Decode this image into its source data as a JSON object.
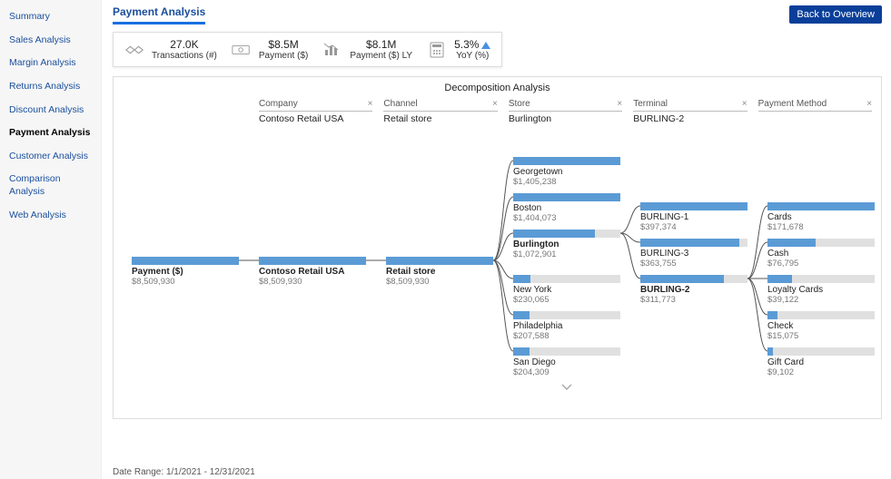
{
  "sidebar": {
    "items": [
      {
        "label": "Summary"
      },
      {
        "label": "Sales Analysis"
      },
      {
        "label": "Margin Analysis"
      },
      {
        "label": "Returns Analysis"
      },
      {
        "label": "Discount Analysis"
      },
      {
        "label": "Payment Analysis"
      },
      {
        "label": "Customer Analysis"
      },
      {
        "label": "Comparison Analysis"
      },
      {
        "label": "Web Analysis"
      }
    ],
    "active_index": 5
  },
  "header": {
    "title": "Payment Analysis",
    "back_label": "Back to Overview"
  },
  "kpis": [
    {
      "icon": "handshake-icon",
      "value": "27.0K",
      "label": "Transactions (#)"
    },
    {
      "icon": "cash-icon",
      "value": "$8.5M",
      "label": "Payment ($)"
    },
    {
      "icon": "chart-icon",
      "value": "$8.1M",
      "label": "Payment ($) LY"
    },
    {
      "icon": "calculator-icon",
      "value": "5.3%",
      "label": "YoY (%)",
      "trend": "up"
    }
  ],
  "decomp": {
    "title": "Decomposition Analysis",
    "breadcrumbs": [
      {
        "name": "Company",
        "value": "Contoso Retail USA"
      },
      {
        "name": "Channel",
        "value": "Retail store"
      },
      {
        "name": "Store",
        "value": "Burlington"
      },
      {
        "name": "Terminal",
        "value": "BURLING-2"
      },
      {
        "name": "Payment Method",
        "value": ""
      }
    ],
    "root": {
      "name": "Payment ($)",
      "value": "$8,509,930"
    },
    "company": {
      "name": "Contoso Retail USA",
      "value": "$8,509,930"
    },
    "channel": {
      "name": "Retail store",
      "value": "$8,509,930"
    },
    "stores": [
      {
        "name": "Georgetown",
        "value": "$1,405,238"
      },
      {
        "name": "Boston",
        "value": "$1,404,073"
      },
      {
        "name": "Burlington",
        "value": "$1,072,901",
        "selected": true
      },
      {
        "name": "New York",
        "value": "$230,065"
      },
      {
        "name": "Philadelphia",
        "value": "$207,588"
      },
      {
        "name": "San Diego",
        "value": "$204,309"
      }
    ],
    "terminals": [
      {
        "name": "BURLING-1",
        "value": "$397,374"
      },
      {
        "name": "BURLING-3",
        "value": "$363,755"
      },
      {
        "name": "BURLING-2",
        "value": "$311,773",
        "selected": true
      }
    ],
    "methods": [
      {
        "name": "Cards",
        "value": "$171,678"
      },
      {
        "name": "Cash",
        "value": "$76,795"
      },
      {
        "name": "Loyalty Cards",
        "value": "$39,122"
      },
      {
        "name": "Check",
        "value": "$15,075"
      },
      {
        "name": "Gift Card",
        "value": "$9,102"
      }
    ]
  },
  "footer": {
    "date_range_label": "Date Range:",
    "date_range_value": "1/1/2021 - 12/31/2021"
  },
  "chart_data": {
    "type": "tree",
    "title": "Decomposition Analysis",
    "measure": "Payment ($)",
    "root_value": 8509930,
    "levels": [
      {
        "name": "Company",
        "items": [
          {
            "label": "Contoso Retail USA",
            "value": 8509930,
            "selected": true
          }
        ]
      },
      {
        "name": "Channel",
        "items": [
          {
            "label": "Retail store",
            "value": 8509930,
            "selected": true
          }
        ]
      },
      {
        "name": "Store",
        "items": [
          {
            "label": "Georgetown",
            "value": 1405238
          },
          {
            "label": "Boston",
            "value": 1404073
          },
          {
            "label": "Burlington",
            "value": 1072901,
            "selected": true
          },
          {
            "label": "New York",
            "value": 230065
          },
          {
            "label": "Philadelphia",
            "value": 207588
          },
          {
            "label": "San Diego",
            "value": 204309
          }
        ]
      },
      {
        "name": "Terminal",
        "items": [
          {
            "label": "BURLING-1",
            "value": 397374
          },
          {
            "label": "BURLING-3",
            "value": 363755
          },
          {
            "label": "BURLING-2",
            "value": 311773,
            "selected": true
          }
        ]
      },
      {
        "name": "Payment Method",
        "items": [
          {
            "label": "Cards",
            "value": 171678
          },
          {
            "label": "Cash",
            "value": 76795
          },
          {
            "label": "Loyalty Cards",
            "value": 39122
          },
          {
            "label": "Check",
            "value": 15075
          },
          {
            "label": "Gift Card",
            "value": 9102
          }
        ]
      }
    ]
  },
  "colors": {
    "accent": "#5b9bd5",
    "link": "#1a4f9c",
    "back_btn": "#0a3f99"
  }
}
